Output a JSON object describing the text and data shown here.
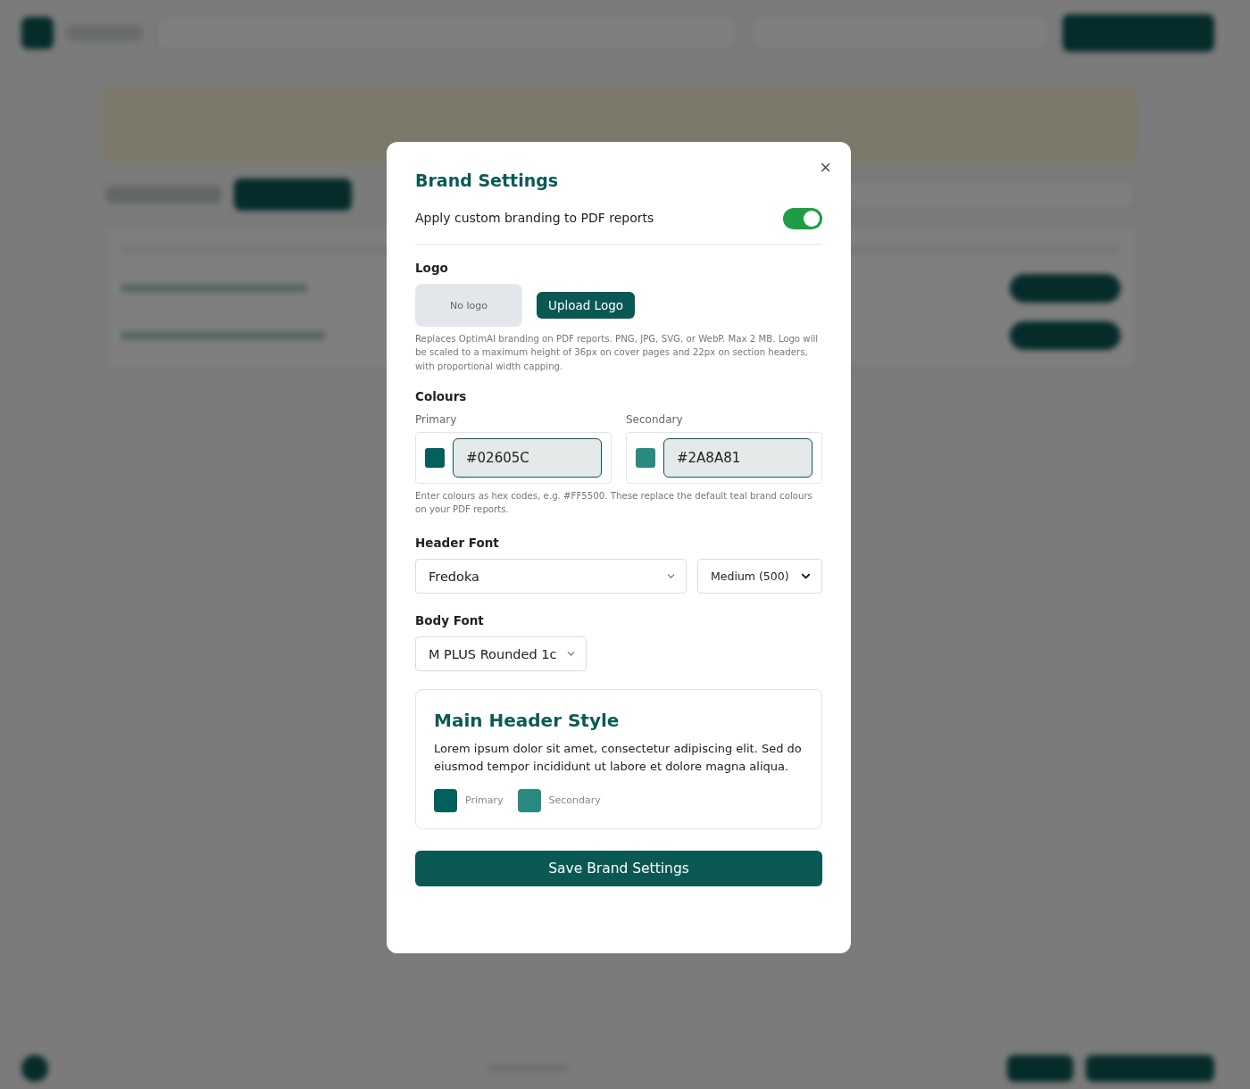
{
  "modal": {
    "title": "Brand Settings",
    "close": "×",
    "branding_toggle": {
      "label": "Apply custom branding to PDF reports",
      "on": true
    },
    "logo": {
      "heading": "Logo",
      "preview": "No logo",
      "upload_button": "Upload Logo",
      "help": "Replaces OptimAI branding on PDF reports. PNG, JPG, SVG, or WebP. Max 2 MB. Logo will be scaled to a maximum height of 36px on cover pages and 22px on section headers, with proportional width capping."
    },
    "colours": {
      "heading": "Colours",
      "fields": [
        {
          "label": "Primary",
          "value": "#02605C",
          "color": "#02605c"
        },
        {
          "label": "Secondary",
          "value": "#2A8A81",
          "color": "#2a8a81"
        }
      ],
      "help": "Enter colours as hex codes, e.g. #FF5500. These replace the default teal brand colours on your PDF reports."
    },
    "header_font": {
      "heading": "Header Font",
      "family": "Fredoka",
      "weight": "Medium (500)"
    },
    "body_font": {
      "heading": "Body Font",
      "family": "M PLUS Rounded 1c"
    },
    "preview": {
      "title": "Main Header Style",
      "body": "Lorem ipsum dolor sit amet, consectetur adipiscing elit. Sed do eiusmod tempor incididunt ut labore et dolore magna aliqua.",
      "swatches": [
        {
          "label": "Primary",
          "color": "#02605c"
        },
        {
          "label": "Secondary",
          "color": "#2a8a81"
        }
      ]
    },
    "save_button": "Save Brand Settings"
  }
}
